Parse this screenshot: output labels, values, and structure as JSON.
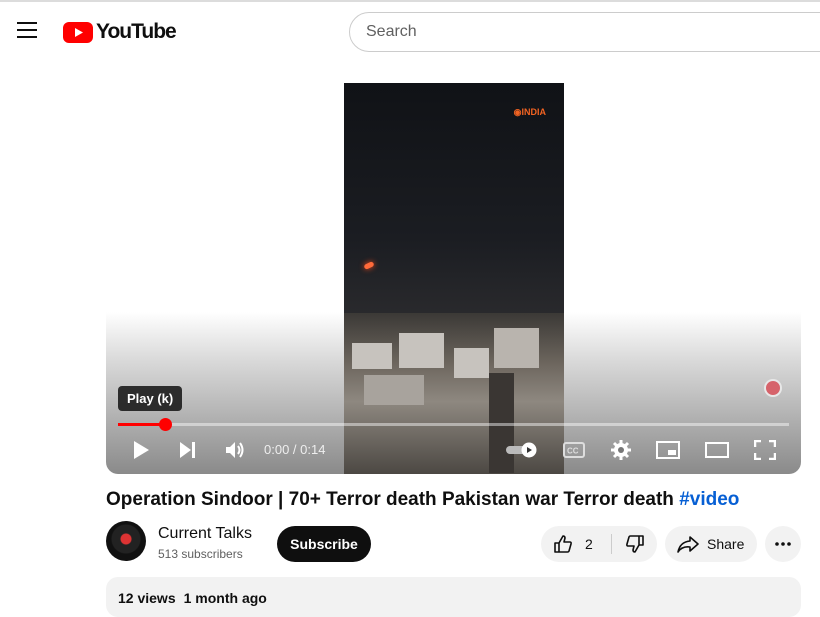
{
  "header": {
    "logo_text": "YouTube",
    "search_placeholder": "Search",
    "menu_icon": "hamburger-icon",
    "logo_icon": "youtube-play-icon"
  },
  "player": {
    "tooltip": "Play (k)",
    "time": "0:00 / 0:14",
    "progress_fraction": 0.07,
    "watermark": "INDIA",
    "controls": [
      "play-icon",
      "next-icon",
      "volume-icon",
      "autoplay-toggle-icon",
      "captions-icon",
      "settings-icon",
      "miniplayer-icon",
      "theater-icon",
      "fullscreen-icon"
    ]
  },
  "video": {
    "title_main": "Operation Sindoor | 70+ Terror death Pakistan war Terror death ",
    "title_hashtag": "#video"
  },
  "channel": {
    "name": "Current Talks",
    "subscribers": "513 subscribers",
    "subscribe_label": "Subscribe"
  },
  "actions": {
    "like_count": "2",
    "share_label": "Share"
  },
  "description": {
    "views": "12 views",
    "date": "1 month ago"
  },
  "colors": {
    "brand_red": "#ff0000",
    "link_blue": "#065fd4"
  }
}
